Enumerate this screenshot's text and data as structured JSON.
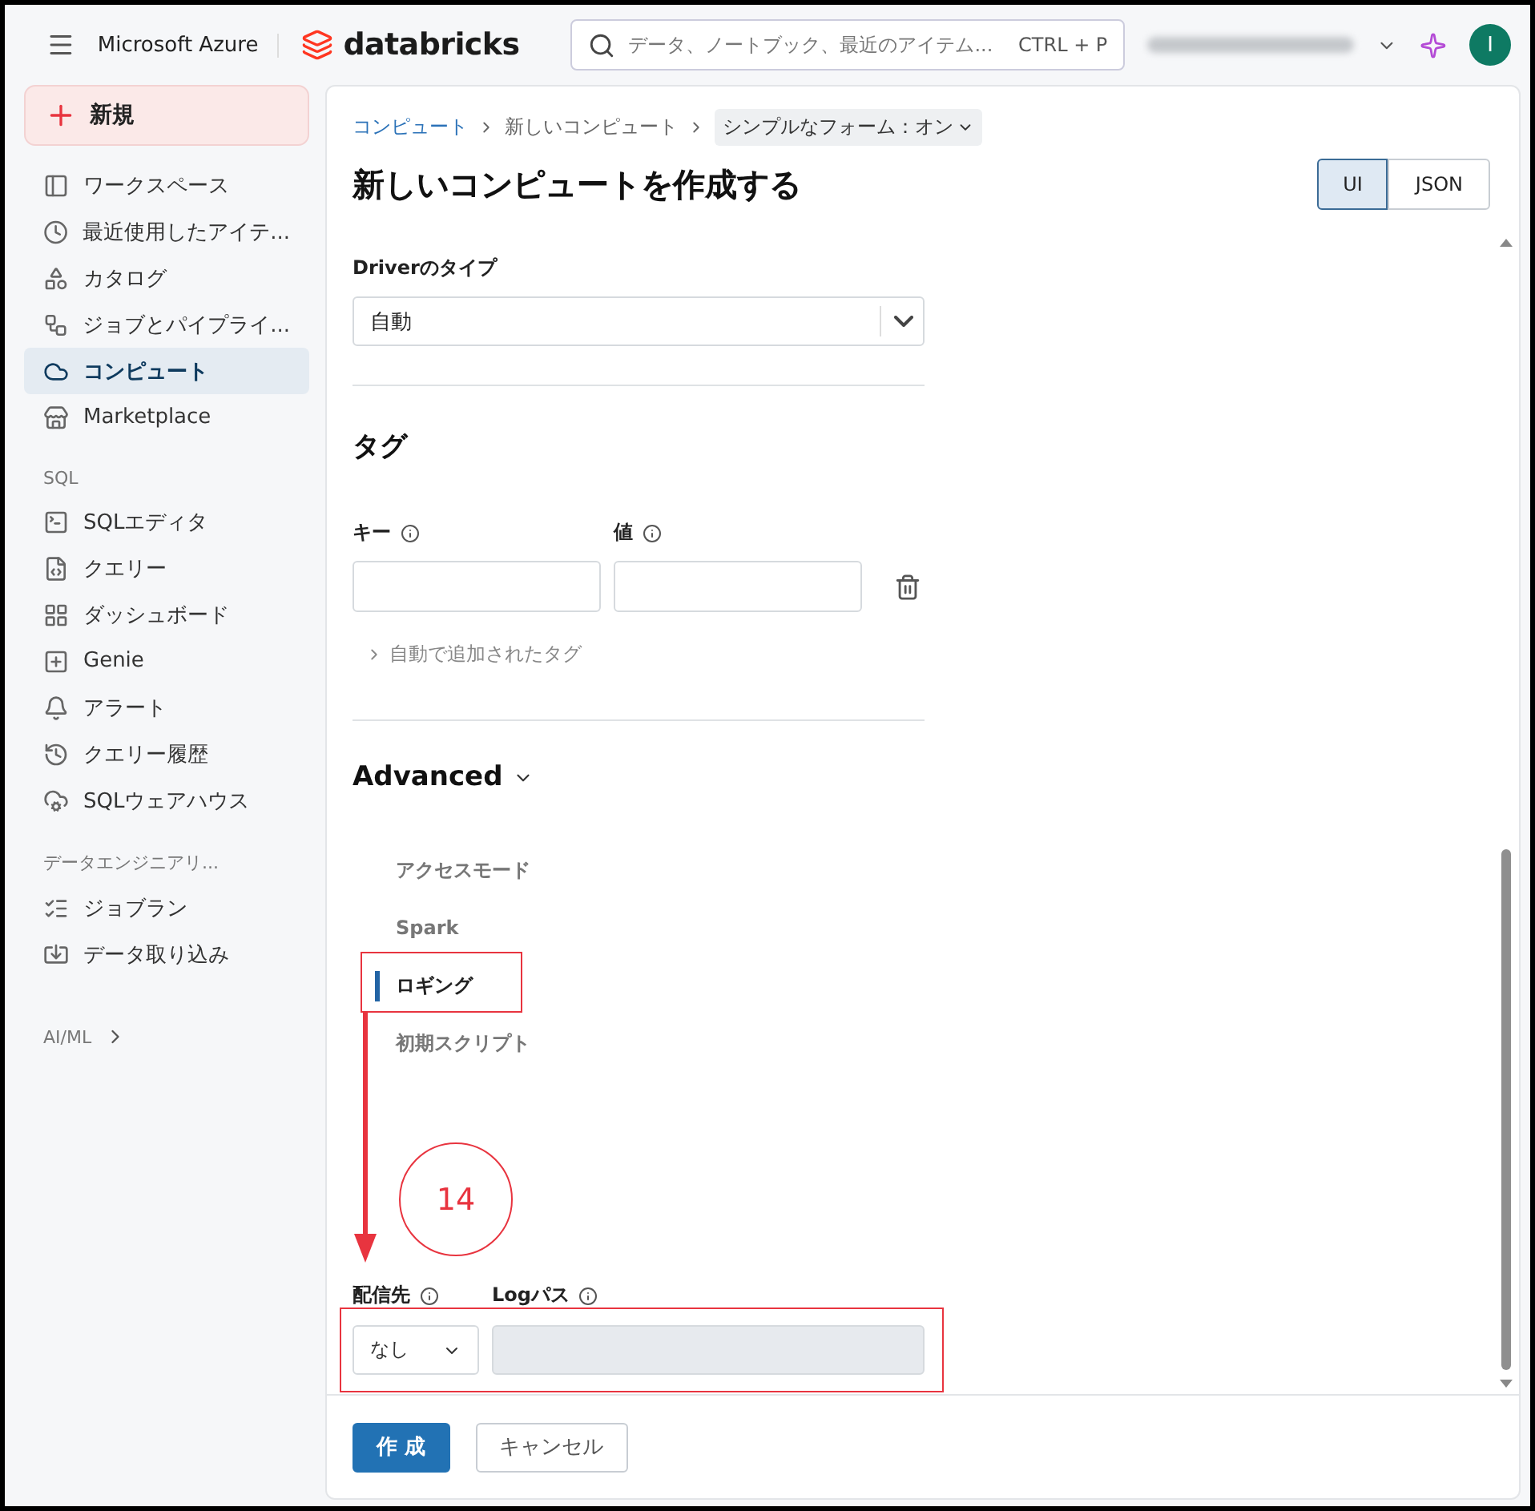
{
  "topbar": {
    "brand": "Microsoft Azure",
    "logo_text": "databricks",
    "search": {
      "placeholder": "データ、ノートブック、最近のアイテム...",
      "shortcut": "CTRL + P"
    },
    "avatar_initial": "I"
  },
  "sidebar": {
    "new_button": "新規",
    "sections": [
      {
        "items": [
          {
            "label": "ワークスペース",
            "selected": false
          },
          {
            "label": "最近使用したアイテ...",
            "selected": false
          },
          {
            "label": "カタログ",
            "selected": false
          },
          {
            "label": "ジョブとパイプライ...",
            "selected": false
          },
          {
            "label": "コンピュート",
            "selected": true
          },
          {
            "label": "Marketplace",
            "selected": false
          }
        ]
      },
      {
        "heading": "SQL",
        "items": [
          {
            "label": "SQLエディタ",
            "selected": false
          },
          {
            "label": "クエリー",
            "selected": false
          },
          {
            "label": "ダッシュボード",
            "selected": false
          },
          {
            "label": "Genie",
            "selected": false
          },
          {
            "label": "アラート",
            "selected": false
          },
          {
            "label": "クエリー履歴",
            "selected": false
          },
          {
            "label": "SQLウェアハウス",
            "selected": false
          }
        ]
      },
      {
        "heading": "データエンジニアリ...",
        "items": [
          {
            "label": "ジョブラン",
            "selected": false
          },
          {
            "label": "データ取り込み",
            "selected": false
          }
        ]
      }
    ],
    "collapsed_section": "AI/ML"
  },
  "main": {
    "breadcrumb": [
      {
        "label": "コンピュート",
        "kind": "link"
      },
      {
        "label": "新しいコンピュート",
        "kind": "text"
      },
      {
        "label": "シンプルなフォーム：オン",
        "kind": "dropdown"
      }
    ],
    "title": "新しいコンピュートを作成する",
    "view_toggle": [
      {
        "label": "UI",
        "selected": true
      },
      {
        "label": "JSON",
        "selected": false
      }
    ],
    "driver_type": {
      "label": "Driverのタイプ",
      "value": "自動"
    },
    "tags": {
      "heading": "タグ",
      "key_label": "キー",
      "value_label": "値",
      "auto_tags_label": "自動で追加されたタグ"
    },
    "advanced": {
      "heading": "Advanced",
      "expanded": true,
      "nav": [
        {
          "label": "アクセスモード",
          "selected": false
        },
        {
          "label": "Spark",
          "selected": false
        },
        {
          "label": "ロギング",
          "selected": true
        },
        {
          "label": "初期スクリプト",
          "selected": false
        }
      ]
    },
    "logging": {
      "destination_label": "配信先",
      "destination_value": "なし",
      "log_path_label": "Logパス",
      "log_path_disabled": true
    },
    "buttons": [
      {
        "label": "作 成",
        "kind": "primary"
      },
      {
        "label": "キャンセル",
        "kind": "secondary"
      }
    ],
    "annotation": {
      "number": "14"
    }
  }
}
